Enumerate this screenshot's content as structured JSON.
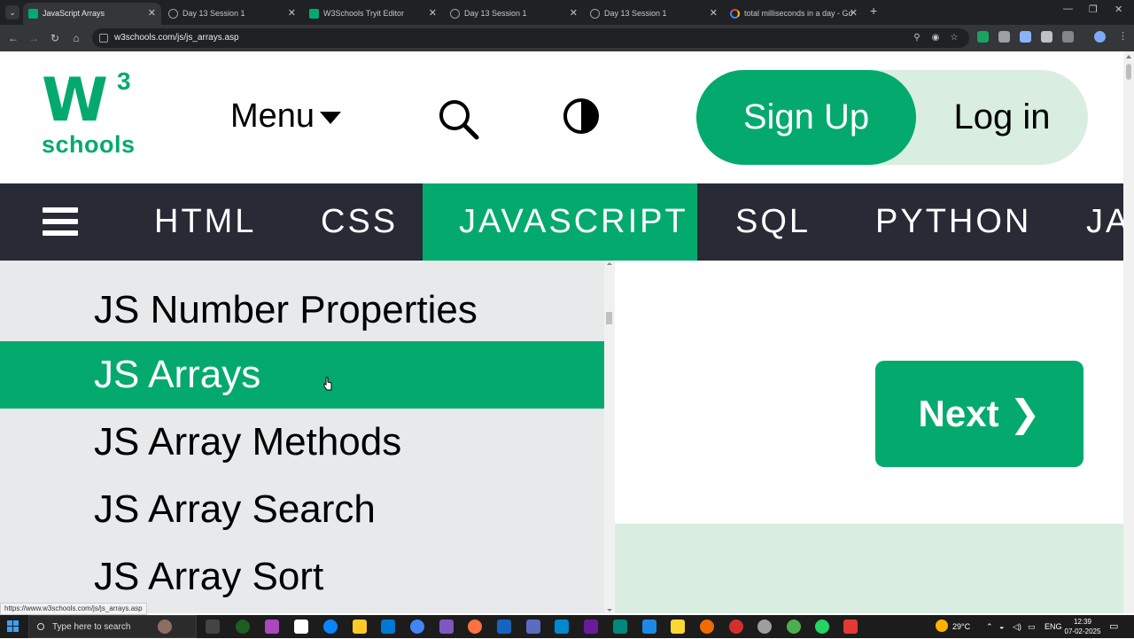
{
  "browser": {
    "tabs": [
      {
        "title": "JavaScript Arrays",
        "active": true
      },
      {
        "title": "Day 13 Session 1",
        "active": false
      },
      {
        "title": "W3Schools Tryit Editor",
        "active": false
      },
      {
        "title": "Day 13 Session 1",
        "active": false
      },
      {
        "title": "Day 13 Session 1",
        "active": false
      },
      {
        "title": "total milliseconds in a day - Go",
        "active": false
      }
    ],
    "new_tab": "+",
    "close_glyph": "✕",
    "url": "w3schools.com/js/js_arrays.asp",
    "status_url": "https://www.w3schools.com/js/js_arrays.asp"
  },
  "header": {
    "logo_w3": "W",
    "logo_sup": "3",
    "logo_schools": "schools",
    "menu_label": "Menu",
    "signup_label": "Sign Up",
    "login_label": "Log in"
  },
  "nav": {
    "items": [
      "HTML",
      "CSS",
      "JAVASCRIPT",
      "SQL",
      "PYTHON",
      "JA"
    ],
    "active_index": 2
  },
  "sidebar": {
    "items": [
      "JS Number Properties",
      "JS Arrays",
      "JS Array Methods",
      "JS Array Search",
      "JS Array Sort"
    ],
    "active_index": 1
  },
  "main": {
    "next_label": "Next ❯"
  },
  "taskbar": {
    "search_placeholder": "Type here to search",
    "weather": "29°C",
    "language": "ENG",
    "time": "12:39",
    "date": "07-02-2025"
  },
  "colors": {
    "brand_green": "#04aa6d",
    "nav_dark": "#282a35",
    "sidebar_bg": "#e7e9eb",
    "light_green": "#d9eee1"
  }
}
